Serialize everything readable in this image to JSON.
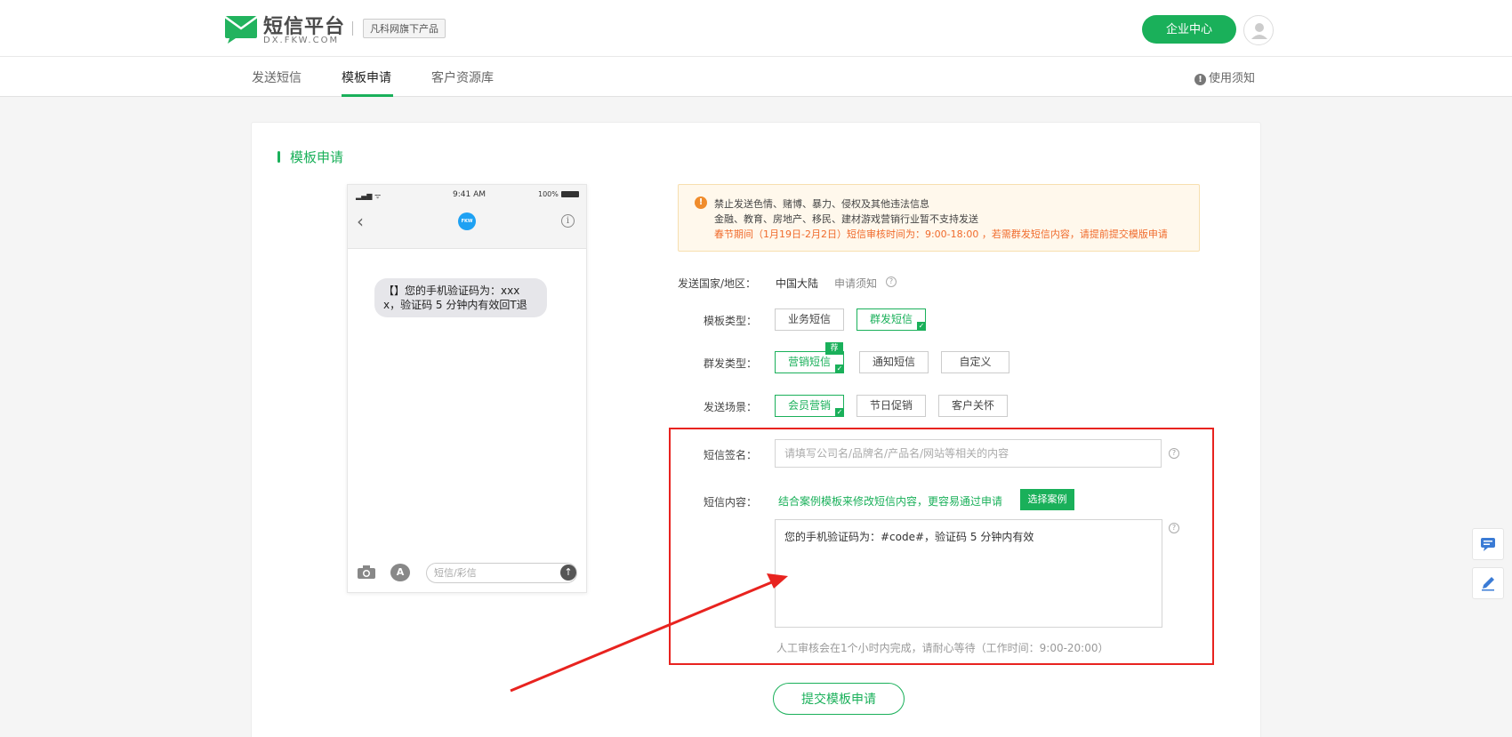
{
  "header": {
    "logo_title": "短信平台",
    "logo_sub": "DX.FKW.COM",
    "logo_tag": "凡科网旗下产品",
    "enterprise_button": "企业中心"
  },
  "nav": {
    "tabs": [
      "发送短信",
      "模板申请",
      "客户资源库"
    ],
    "active": "模板申请",
    "guide": "使用须知"
  },
  "card": {
    "title": "模板申请"
  },
  "phone": {
    "time": "9:41 AM",
    "battery": "100%",
    "logo_text": "FKW",
    "message": "【】您的手机验证码为：xxx x，验证码 5 分钟内有效回T退",
    "input_placeholder": "短信/彩信"
  },
  "warning": {
    "line1": "禁止发送色情、赌博、暴力、侵权及其他违法信息",
    "line2": "金融、教育、房地产、移民、建材游戏营销行业暂不支持发送",
    "line3": "春节期间（1月19日-2月2日）短信审核时间为：9:00-18:00 ，若需群发短信内容，请提前提交模版申请"
  },
  "form": {
    "country_label": "发送国家/地区：",
    "country_value": "中国大陆",
    "country_hint": "申请须知",
    "tpl_type_label": "模板类型：",
    "tpl_types": [
      "业务短信",
      "群发短信"
    ],
    "tpl_type_selected": "群发短信",
    "mass_type_label": "群发类型：",
    "mass_types": [
      "营销短信",
      "通知短信",
      "自定义"
    ],
    "mass_type_selected": "营销短信",
    "recommend_tag": "荐",
    "scene_label": "发送场景：",
    "scenes": [
      "会员营销",
      "节日促销",
      "客户关怀"
    ],
    "scene_selected": "会员营销",
    "sign_label": "短信签名：",
    "sign_placeholder": "请填写公司名/品牌名/产品名/网站等相关的内容",
    "content_label": "短信内容：",
    "content_hint": "结合案例模板来修改短信内容，更容易通过申请",
    "case_button": "选择案例",
    "content_value": "您的手机验证码为：#code#，验证码 5 分钟内有效",
    "review_note": "人工审核会在1个小时内完成，请耐心等待（工作时间：9:00-20:00）",
    "submit_button": "提交模板申请"
  },
  "colors": {
    "brand": "#1ab05a",
    "warning": "#f06b2c",
    "annotation": "#e8231f"
  }
}
